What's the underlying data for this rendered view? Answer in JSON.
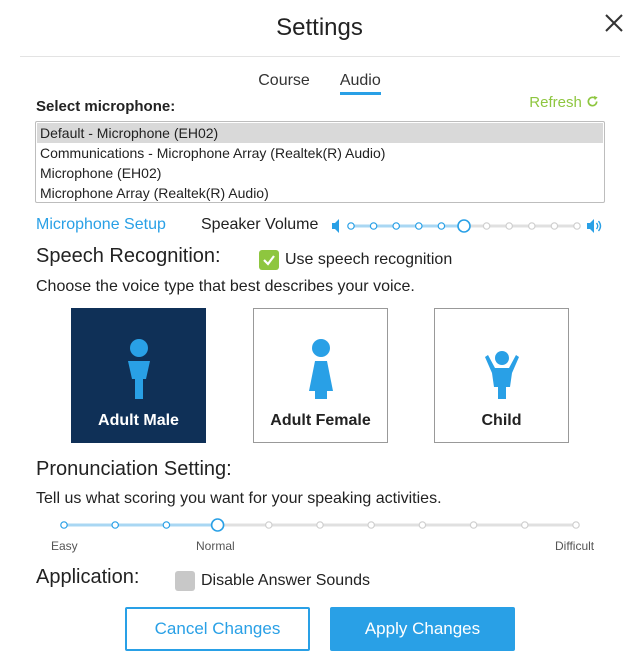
{
  "header": {
    "title": "Settings"
  },
  "tabs": [
    {
      "label": "Course",
      "active": false
    },
    {
      "label": "Audio",
      "active": true
    }
  ],
  "microphone": {
    "label": "Select microphone:",
    "refresh_label": "Refresh",
    "options": [
      "Default - Microphone (EH02)",
      "Communications - Microphone Array (Realtek(R) Audio)",
      "Microphone (EH02)",
      "Microphone Array (Realtek(R) Audio)"
    ],
    "selected_index": 0
  },
  "speaker": {
    "setup_link": "Microphone Setup",
    "volume_label": "Speaker Volume",
    "volume_steps": 11,
    "volume_level_step": 5
  },
  "speech": {
    "title": "Speech Recognition:",
    "checkbox_label": "Use speech recognition",
    "checkbox_checked": true,
    "voice_prompt": "Choose the voice type that best describes your voice.",
    "voices": [
      {
        "label": "Adult Male",
        "icon": "male-figure-icon",
        "selected": true
      },
      {
        "label": "Adult Female",
        "icon": "female-figure-icon",
        "selected": false
      },
      {
        "label": "Child",
        "icon": "child-figure-icon",
        "selected": false
      }
    ]
  },
  "pronunciation": {
    "title": "Pronunciation Setting:",
    "description": "Tell us what scoring you want for your speaking activities.",
    "min_label": "Easy",
    "mid_label": "Normal",
    "max_label": "Difficult",
    "steps": 11,
    "level_step": 3
  },
  "application": {
    "title": "Application:",
    "checkbox_label": "Disable Answer Sounds",
    "checkbox_checked": false
  },
  "buttons": {
    "cancel": "Cancel Changes",
    "apply": "Apply Changes"
  },
  "colors": {
    "accent": "#29a0e6",
    "green": "#8ec63f",
    "selected_card": "#0f3057",
    "slider_track": "#e0e0e0",
    "slider_fill": "#a9d7f3"
  }
}
